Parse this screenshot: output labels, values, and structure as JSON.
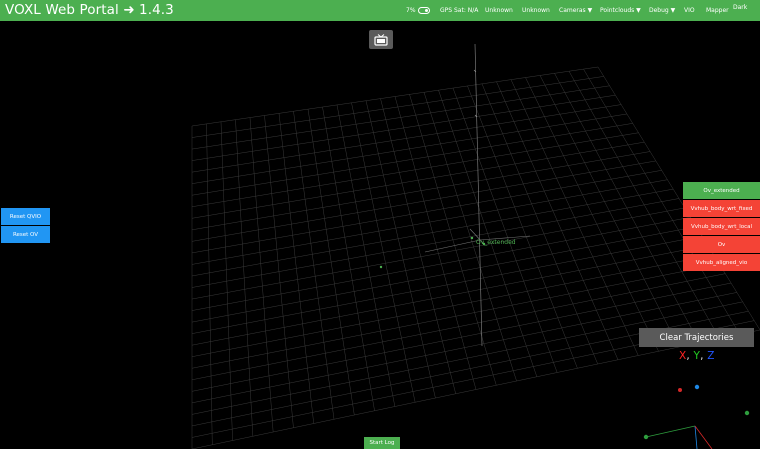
{
  "header": {
    "title": "VOXL Web Portal ➜ 1.4.3",
    "battery": "7%",
    "gps": "GPS Sat: N/A",
    "status_1": "Unknown",
    "status_2": "Unknown",
    "menu_cameras": "Cameras ▼",
    "menu_pointclouds": "Pointclouds ▼",
    "menu_debug": "Debug ▼",
    "menu_vio": "VIO",
    "menu_mapper": "Mapper",
    "theme": "Dark"
  },
  "left_controls": {
    "reset_qvio": "Reset QVIO",
    "reset_ov": "Reset OV"
  },
  "scene": {
    "frame_label": "Ov_extended"
  },
  "trajectories": [
    {
      "label": "Ov_extended",
      "color": "#4caf50"
    },
    {
      "label": "Vvhub_body_wrt_fixed",
      "color": "#f44336"
    },
    {
      "label": "Vvhub_body_wrt_local",
      "color": "#f44336"
    },
    {
      "label": "Ov",
      "color": "#f44336"
    },
    {
      "label": "Vvhub_aligned_vio",
      "color": "#f44336"
    }
  ],
  "clear_trajectories": "Clear Trajectories",
  "axis_legend": {
    "x": "X",
    "sep1": ",",
    "y": "Y",
    "sep2": ",",
    "z": "Z",
    "x_color": "#ff2222",
    "y_color": "#22cc22",
    "z_color": "#2255ff"
  },
  "start_log": "Start Log",
  "accent_green": "#4caf50",
  "accent_blue": "#2196f3",
  "accent_red": "#f44336"
}
